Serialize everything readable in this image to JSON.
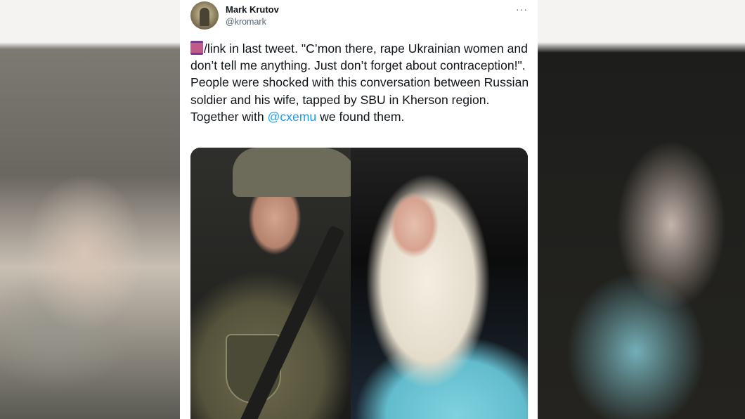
{
  "tweet": {
    "author_name": "Mark Krutov",
    "author_handle": "@kromark",
    "more_icon": "···",
    "emoji_icon": "thread-spool-icon",
    "text_part1": "/link in last tweet. \"C’mon there, rape Ukrainian women and don’t tell me anything. Just don’t forget about contraception!\". People were shocked with this conversation between Russian soldier and his wife, tapped by SBU in Kherson region. Together with ",
    "mention": "@cxemu",
    "text_part2": " we found them."
  },
  "colors": {
    "text": "#0f1419",
    "secondary": "#536471",
    "link": "#1d9bf0"
  }
}
